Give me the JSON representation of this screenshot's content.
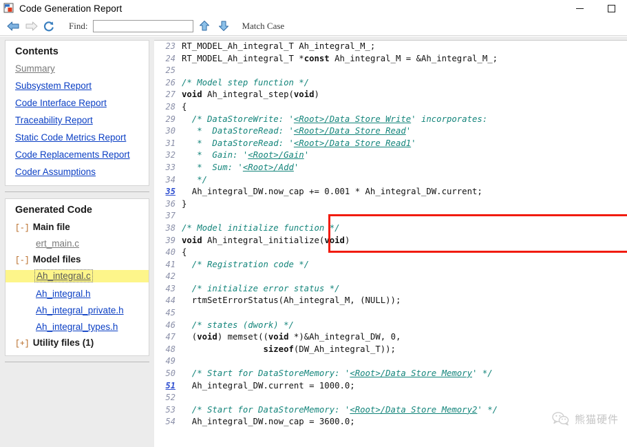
{
  "window": {
    "title": "Code Generation Report",
    "icon": "report-window-icon",
    "minimize_label": "–",
    "maximize_label": "□"
  },
  "toolbar": {
    "back_icon": "back-arrow-icon",
    "forward_icon": "forward-arrow-icon",
    "refresh_icon": "refresh-icon",
    "find_label": "Find:",
    "find_value": "",
    "find_placeholder": "",
    "up_icon": "find-previous-icon",
    "down_icon": "find-next-icon",
    "match_case_label": "Match Case"
  },
  "sidebar": {
    "contents": {
      "title": "Contents",
      "links": [
        {
          "label": "Summary",
          "state": "visited"
        },
        {
          "label": "Subsystem Report",
          "state": "link"
        },
        {
          "label": "Code Interface Report",
          "state": "link"
        },
        {
          "label": "Traceability Report",
          "state": "link"
        },
        {
          "label": "Static Code Metrics Report",
          "state": "link"
        },
        {
          "label": "Code Replacements Report",
          "state": "link"
        },
        {
          "label": "Coder Assumptions",
          "state": "link"
        }
      ]
    },
    "generated_code": {
      "title": "Generated Code",
      "groups": [
        {
          "toggle": "[-]",
          "label": "Main file",
          "files": [
            {
              "label": "ert_main.c",
              "state": "visited"
            }
          ]
        },
        {
          "toggle": "[-]",
          "label": "Model files",
          "files": [
            {
              "label": "Ah_integral.c",
              "state": "selected"
            },
            {
              "label": "Ah_integral.h",
              "state": "link"
            },
            {
              "label": "Ah_integral_private.h",
              "state": "link"
            },
            {
              "label": "Ah_integral_types.h",
              "state": "link"
            }
          ]
        },
        {
          "toggle": "[+]",
          "label": "Utility files (1)",
          "files": []
        }
      ]
    }
  },
  "code": {
    "first_line_number": 23,
    "lines": [
      {
        "n": 23,
        "hl": false,
        "clipped": "top",
        "tokens": [
          {
            "t": "src",
            "s": "RT_MODEL_Ah_integral_T Ah_integral_M_;"
          }
        ]
      },
      {
        "n": 24,
        "hl": false,
        "tokens": [
          {
            "t": "src",
            "s": "RT_MODEL_Ah_integral_T *"
          },
          {
            "t": "kw",
            "s": "const"
          },
          {
            "t": "src",
            "s": " Ah_integral_M = &Ah_integral_M_;"
          }
        ]
      },
      {
        "n": 25,
        "hl": false,
        "tokens": []
      },
      {
        "n": 26,
        "hl": false,
        "tokens": [
          {
            "t": "cmt",
            "s": "/* Model step function */"
          }
        ]
      },
      {
        "n": 27,
        "hl": false,
        "tokens": [
          {
            "t": "kw",
            "s": "void"
          },
          {
            "t": "src",
            "s": " Ah_integral_step("
          },
          {
            "t": "kw",
            "s": "void"
          },
          {
            "t": "src",
            "s": ")"
          }
        ]
      },
      {
        "n": 28,
        "hl": false,
        "tokens": [
          {
            "t": "src",
            "s": "{"
          }
        ]
      },
      {
        "n": 29,
        "hl": false,
        "tokens": [
          {
            "t": "cmt",
            "s": "  /* DataStoreWrite: '"
          },
          {
            "t": "lnk",
            "s": "<Root>/Data Store Write"
          },
          {
            "t": "cmt",
            "s": "' incorporates:"
          }
        ]
      },
      {
        "n": 30,
        "hl": false,
        "tokens": [
          {
            "t": "cmt",
            "s": "   *  DataStoreRead: '"
          },
          {
            "t": "lnk",
            "s": "<Root>/Data Store Read"
          },
          {
            "t": "cmt",
            "s": "'"
          }
        ]
      },
      {
        "n": 31,
        "hl": false,
        "tokens": [
          {
            "t": "cmt",
            "s": "   *  DataStoreRead: '"
          },
          {
            "t": "lnk",
            "s": "<Root>/Data Store Read1"
          },
          {
            "t": "cmt",
            "s": "'"
          }
        ]
      },
      {
        "n": 32,
        "hl": false,
        "tokens": [
          {
            "t": "cmt",
            "s": "   *  Gain: '"
          },
          {
            "t": "lnk",
            "s": "<Root>/Gain"
          },
          {
            "t": "cmt",
            "s": "'"
          }
        ]
      },
      {
        "n": 33,
        "hl": false,
        "tokens": [
          {
            "t": "cmt",
            "s": "   *  Sum: '"
          },
          {
            "t": "lnk",
            "s": "<Root>/Add"
          },
          {
            "t": "cmt",
            "s": "'"
          }
        ]
      },
      {
        "n": 34,
        "hl": false,
        "tokens": [
          {
            "t": "cmt",
            "s": "   */"
          }
        ]
      },
      {
        "n": 35,
        "hl": true,
        "tokens": [
          {
            "t": "src",
            "s": "  Ah_integral_DW.now_cap += 0.001 * Ah_integral_DW.current;"
          }
        ]
      },
      {
        "n": 36,
        "hl": false,
        "tokens": [
          {
            "t": "src",
            "s": "}"
          }
        ]
      },
      {
        "n": 37,
        "hl": false,
        "tokens": []
      },
      {
        "n": 38,
        "hl": false,
        "tokens": [
          {
            "t": "cmt",
            "s": "/* Model initialize function */"
          }
        ]
      },
      {
        "n": 39,
        "hl": false,
        "tokens": [
          {
            "t": "kw",
            "s": "void"
          },
          {
            "t": "src",
            "s": " Ah_integral_initialize("
          },
          {
            "t": "kw",
            "s": "void"
          },
          {
            "t": "src",
            "s": ")"
          }
        ]
      },
      {
        "n": 40,
        "hl": false,
        "tokens": [
          {
            "t": "src",
            "s": "{"
          }
        ]
      },
      {
        "n": 41,
        "hl": false,
        "tokens": [
          {
            "t": "cmt",
            "s": "  /* Registration code */"
          }
        ]
      },
      {
        "n": 42,
        "hl": false,
        "tokens": []
      },
      {
        "n": 43,
        "hl": false,
        "tokens": [
          {
            "t": "cmt",
            "s": "  /* initialize error status */"
          }
        ]
      },
      {
        "n": 44,
        "hl": false,
        "tokens": [
          {
            "t": "src",
            "s": "  rtmSetErrorStatus(Ah_integral_M, (NULL));"
          }
        ]
      },
      {
        "n": 45,
        "hl": false,
        "tokens": []
      },
      {
        "n": 46,
        "hl": false,
        "tokens": [
          {
            "t": "cmt",
            "s": "  /* states (dwork) */"
          }
        ]
      },
      {
        "n": 47,
        "hl": false,
        "tokens": [
          {
            "t": "src",
            "s": "  ("
          },
          {
            "t": "kw",
            "s": "void"
          },
          {
            "t": "src",
            "s": ") memset(("
          },
          {
            "t": "kw",
            "s": "void"
          },
          {
            "t": "src",
            "s": " *)&Ah_integral_DW, 0,"
          }
        ]
      },
      {
        "n": 48,
        "hl": false,
        "tokens": [
          {
            "t": "src",
            "s": "                "
          },
          {
            "t": "kw",
            "s": "sizeof"
          },
          {
            "t": "src",
            "s": "(DW_Ah_integral_T));"
          }
        ]
      },
      {
        "n": 49,
        "hl": false,
        "tokens": []
      },
      {
        "n": 50,
        "hl": false,
        "tokens": [
          {
            "t": "cmt",
            "s": "  /* Start for DataStoreMemory: '"
          },
          {
            "t": "lnk",
            "s": "<Root>/Data Store Memory"
          },
          {
            "t": "cmt",
            "s": "' */"
          }
        ]
      },
      {
        "n": 51,
        "hl": true,
        "tokens": [
          {
            "t": "src",
            "s": "  Ah_integral_DW.current = 1000.0;"
          }
        ]
      },
      {
        "n": 52,
        "hl": false,
        "tokens": []
      },
      {
        "n": 53,
        "hl": false,
        "tokens": [
          {
            "t": "cmt",
            "s": "  /* Start for DataStoreMemory: '"
          },
          {
            "t": "lnk",
            "s": "<Root>/Data Store Memory2"
          },
          {
            "t": "cmt",
            "s": "' */"
          }
        ]
      },
      {
        "n": 54,
        "hl": false,
        "clipped": "bottom",
        "tokens": [
          {
            "t": "src",
            "s": "  Ah_integral_DW.now_cap = 3600.0;"
          }
        ]
      }
    ]
  },
  "annotation": {
    "redbox_color": "#f11b0d",
    "covers_lines": "34-36"
  },
  "watermark": {
    "logo": "wechat-icon",
    "text": "熊猫硬件"
  }
}
